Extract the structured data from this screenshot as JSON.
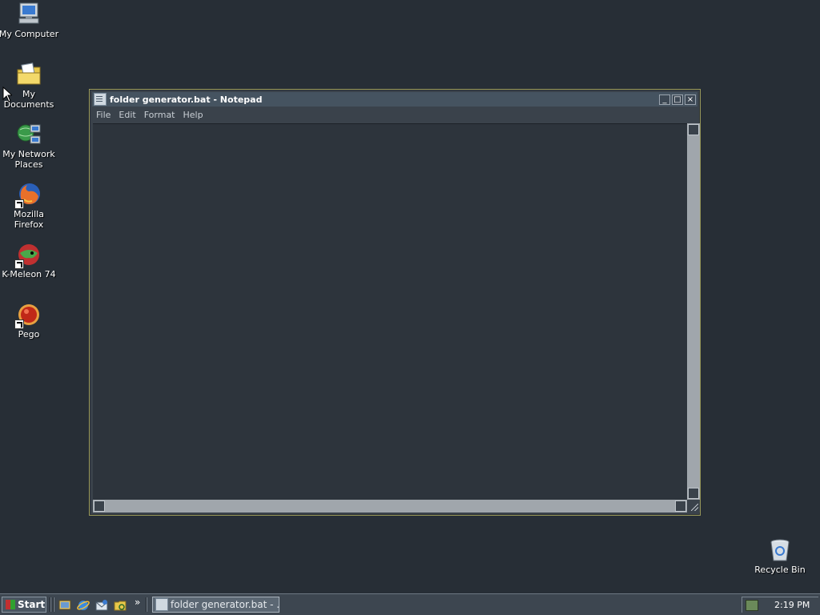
{
  "desktop": {
    "icons": [
      {
        "label": "My Computer"
      },
      {
        "label": "My Documents"
      },
      {
        "label": "My Network Places"
      },
      {
        "label": "Mozilla Firefox"
      },
      {
        "label": "K-Meleon 74"
      },
      {
        "label": "Pego"
      },
      {
        "label": "Recycle Bin"
      }
    ]
  },
  "notepad": {
    "title": "folder generator.bat - Notepad",
    "menu": [
      "File",
      "Edit",
      "Format",
      "Help"
    ],
    "content": "",
    "controls": {
      "minimize": "_",
      "maximize": "□",
      "close": "×"
    }
  },
  "taskbar": {
    "start_label": "Start",
    "chevron": "»",
    "task_button_label": "folder generator.bat - ...",
    "clock": "2:19 PM"
  },
  "colors": {
    "desktop_bg": "#272e36",
    "titlebar": "#455360",
    "taskbar": "#3d4650"
  }
}
